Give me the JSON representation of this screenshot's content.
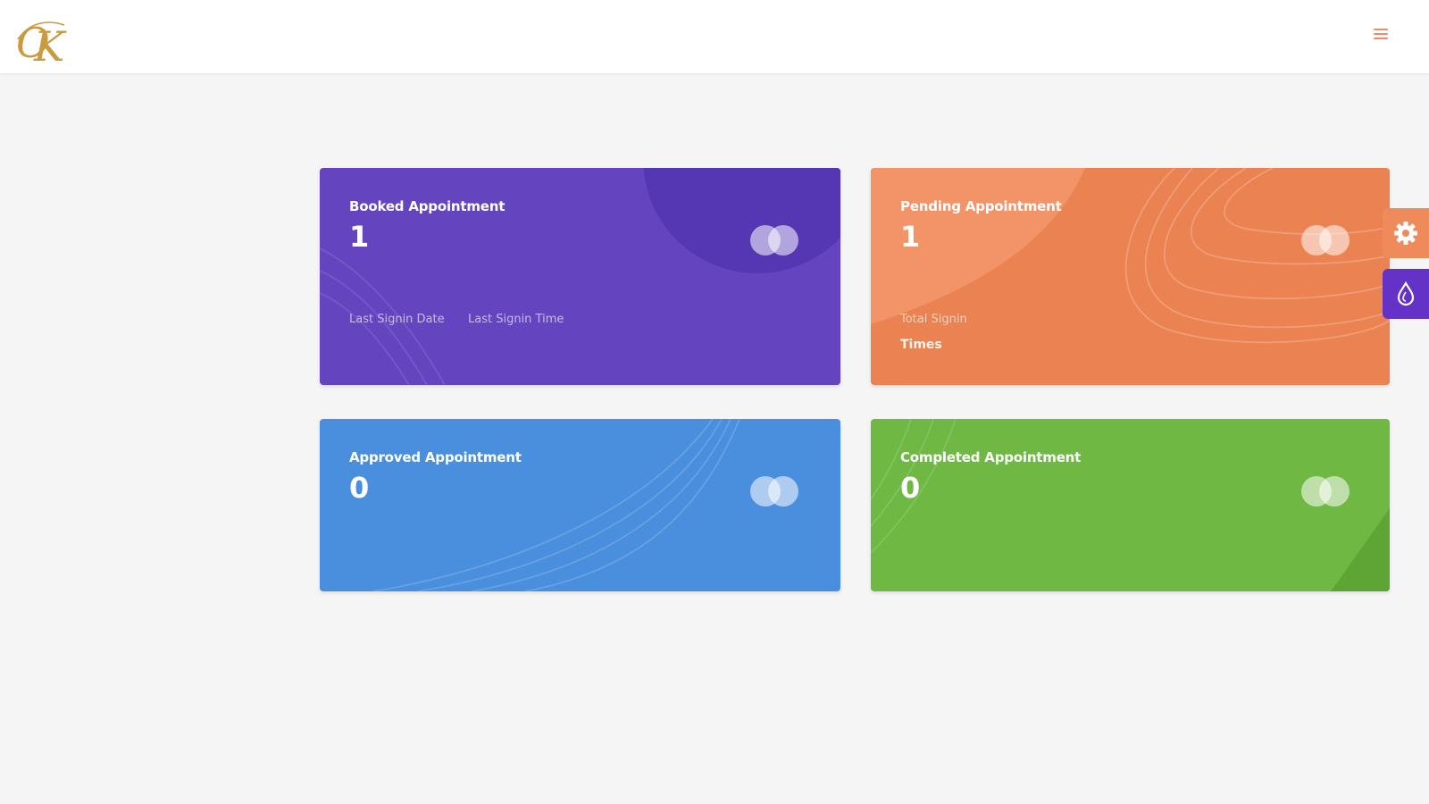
{
  "header": {
    "logo_icon": "ok-monogram-logo",
    "menu_icon": "hamburger-menu-icon"
  },
  "colors": {
    "booked": "#6545bf",
    "pending": "#eb8251",
    "approved": "#4a8fdd",
    "completed": "#6fb844",
    "logo_gold": "#c99a3e"
  },
  "cards": {
    "booked": {
      "title": "Booked Appointment",
      "count": "1",
      "meta_left": "Last Signin Date",
      "meta_right": "Last Signin Time"
    },
    "pending": {
      "title": "Pending Appointment",
      "count": "1",
      "meta_label": "Total Signin",
      "meta_value": "Times"
    },
    "approved": {
      "title": "Approved Appointment",
      "count": "0"
    },
    "completed": {
      "title": "Completed Appointment",
      "count": "0"
    }
  },
  "side_tools": {
    "settings_icon": "gear-icon",
    "theme_icon": "droplet-icon"
  }
}
